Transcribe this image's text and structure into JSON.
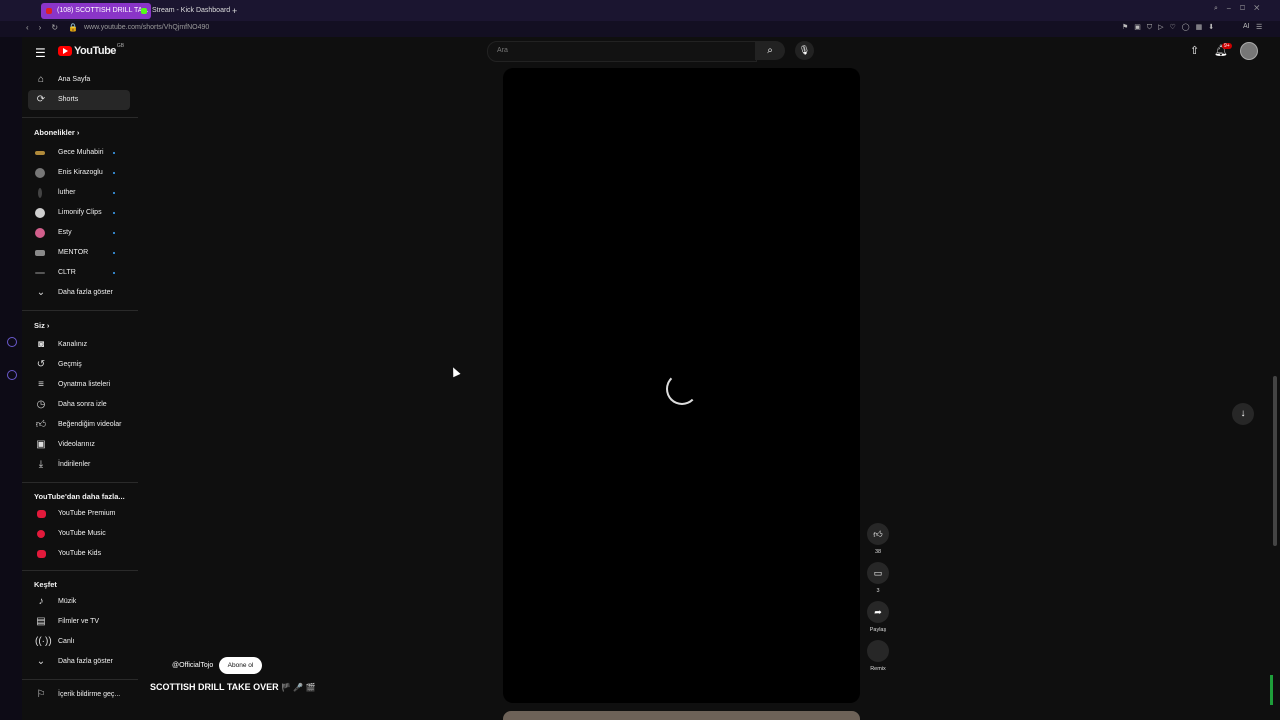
{
  "browser": {
    "tabs": [
      {
        "label": "(108) SCOTTISH DRILL TA...",
        "active": true,
        "favicon_color": "#e02020"
      },
      {
        "label": "Stream - Kick Dashboard",
        "active": false,
        "favicon_color": "#53fc18"
      }
    ],
    "new_tab": "+",
    "url": "www.youtube.com/shorts/VhQjmfNO490",
    "ai_label": "AI"
  },
  "header": {
    "logo_text": "YouTube",
    "logo_country": "GB",
    "search_placeholder": "Ara",
    "notifications_badge": "9+"
  },
  "sidebar": {
    "main_items": [
      {
        "label": "Ana Sayfa",
        "icon": "home-icon"
      },
      {
        "label": "Shorts",
        "icon": "shorts-icon",
        "selected": true
      }
    ],
    "subscriptions_title": "Abonelikler",
    "subscriptions": [
      {
        "label": "Gece Muhabiri",
        "avatar_color": "#b08a3a"
      },
      {
        "label": "Enis Kirazoglu",
        "avatar_color": "#777777"
      },
      {
        "label": "luther",
        "avatar_color": "#444444"
      },
      {
        "label": "Limonify Clips",
        "avatar_color": "#cfcfcf"
      },
      {
        "label": "Esty",
        "avatar_color": "#d25f8c"
      },
      {
        "label": "MENTOR",
        "avatar_color": "#8a8a8a"
      },
      {
        "label": "CLTR",
        "avatar_color": "#333333"
      }
    ],
    "show_more": "Daha fazla göster",
    "you_title": "Siz",
    "you_items": [
      {
        "label": "Kanalınız",
        "icon": "channel-icon"
      },
      {
        "label": "Geçmiş",
        "icon": "history-icon"
      },
      {
        "label": "Oynatma listeleri",
        "icon": "playlist-icon"
      },
      {
        "label": "Daha sonra izle",
        "icon": "clock-icon"
      },
      {
        "label": "Beğendiğim videolar",
        "icon": "like-icon"
      },
      {
        "label": "Videolarınız",
        "icon": "videos-icon"
      },
      {
        "label": "İndirilenler",
        "icon": "download-icon"
      }
    ],
    "more_title": "YouTube'dan daha fazla...",
    "more_items": [
      {
        "label": "YouTube Premium"
      },
      {
        "label": "YouTube Music"
      },
      {
        "label": "YouTube Kids"
      }
    ],
    "explore_title": "Keşfet",
    "explore_items": [
      {
        "label": "Müzik",
        "icon": "music-icon"
      },
      {
        "label": "Filmler ve TV",
        "icon": "film-icon"
      },
      {
        "label": "Canlı",
        "icon": "live-icon"
      }
    ],
    "explore_show_more": "Daha fazla göster",
    "report": "İçerik bildirme geç..."
  },
  "short": {
    "channel": "@OfficialTojo",
    "subscribe_label": "Abone ol",
    "title": "SCOTTISH DRILL TAKE OVER",
    "likes": "38",
    "comments": "3",
    "share_label": "Paylaş",
    "remix_label": "Remix"
  }
}
